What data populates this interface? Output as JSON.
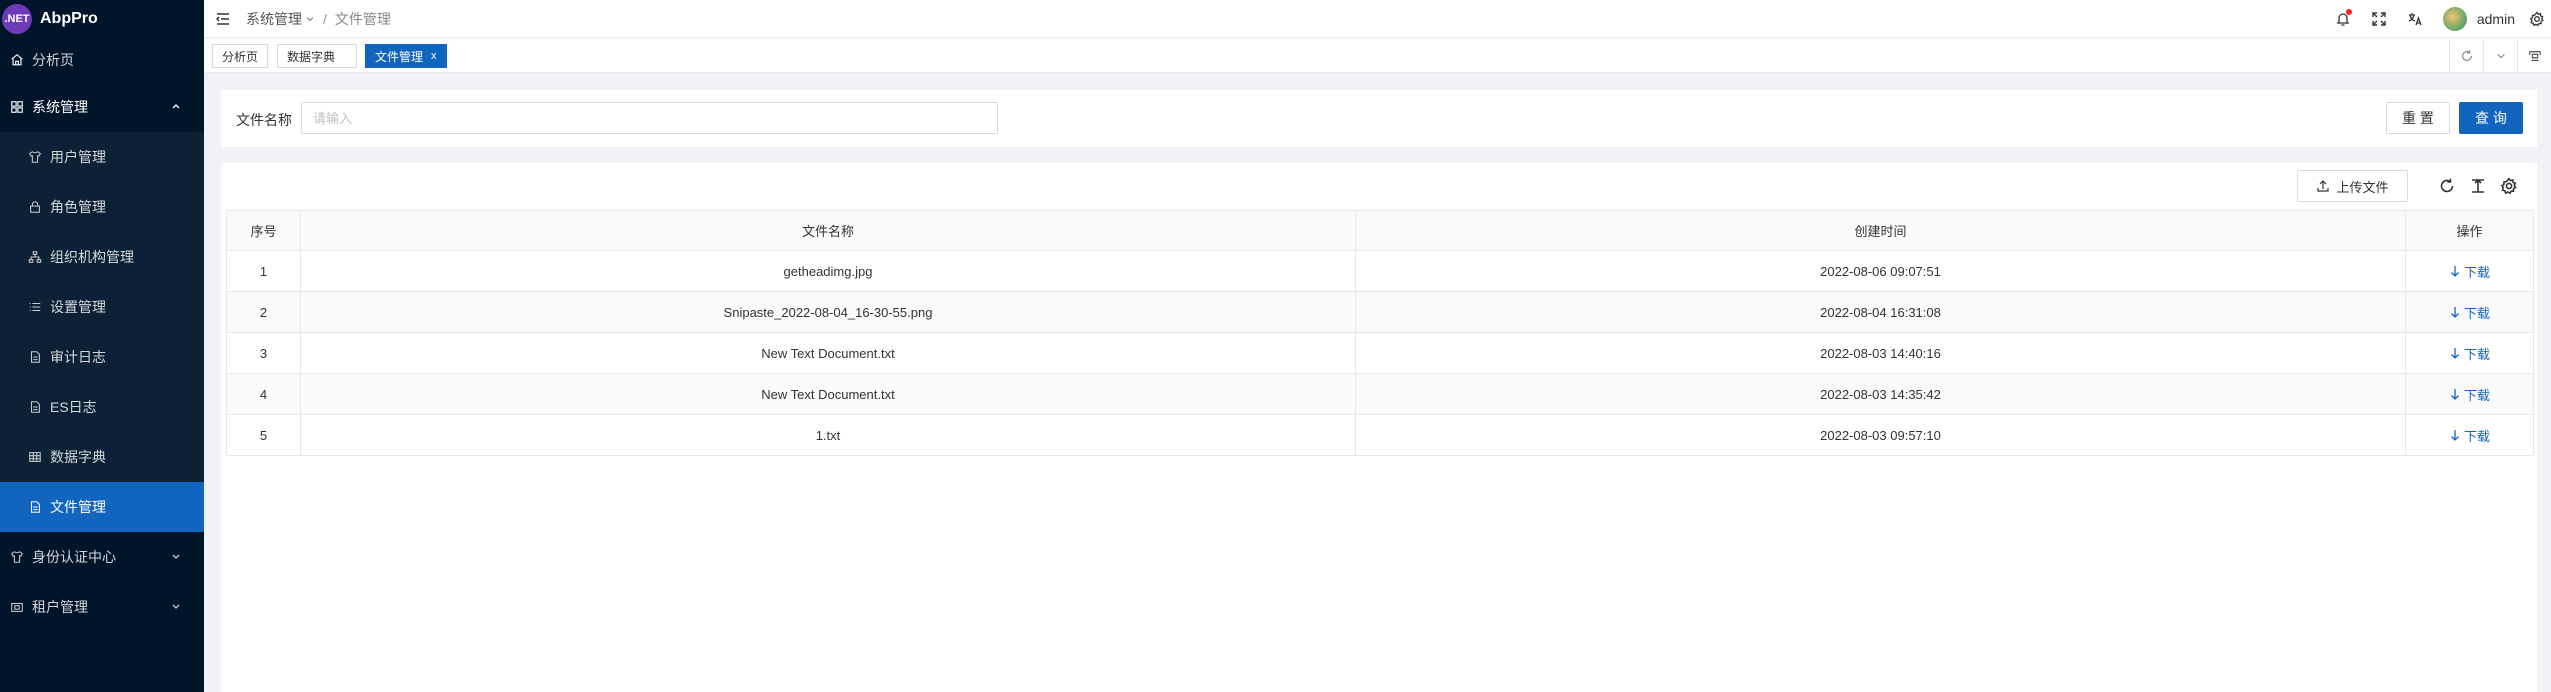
{
  "app": {
    "logo_badge": ".NET",
    "name": "AbpPro"
  },
  "sidebar": {
    "items": [
      {
        "label": "分析页",
        "icon": "home-icon"
      },
      {
        "label": "系统管理",
        "icon": "grid-icon",
        "expanded": true
      },
      {
        "label": "用户管理",
        "icon": "shirt-icon"
      },
      {
        "label": "角色管理",
        "icon": "lock-icon"
      },
      {
        "label": "组织机构管理",
        "icon": "org-icon"
      },
      {
        "label": "设置管理",
        "icon": "list-icon"
      },
      {
        "label": "审计日志",
        "icon": "file-icon"
      },
      {
        "label": "ES日志",
        "icon": "file-icon"
      },
      {
        "label": "数据字典",
        "icon": "table-icon"
      },
      {
        "label": "文件管理",
        "icon": "file-icon",
        "active": true
      },
      {
        "label": "身份认证中心",
        "icon": "shirt-icon"
      },
      {
        "label": "租户管理",
        "icon": "tenant-icon"
      }
    ]
  },
  "header": {
    "breadcrumb": [
      "系统管理",
      "文件管理"
    ],
    "username": "admin"
  },
  "tabs": [
    {
      "label": "分析页"
    },
    {
      "label": "数据字典"
    },
    {
      "label": "文件管理",
      "active": true,
      "close": "x"
    }
  ],
  "search": {
    "label": "文件名称",
    "placeholder": "请输入",
    "value": "",
    "reset_label": "重 置",
    "query_label": "查 询"
  },
  "table": {
    "upload_label": "上传文件",
    "columns": [
      "序号",
      "文件名称",
      "创建时间",
      "操作"
    ],
    "rows": [
      {
        "index": "1",
        "name": "getheadimg.jpg",
        "created": "2022-08-06 09:07:51",
        "action": "下载"
      },
      {
        "index": "2",
        "name": "Snipaste_2022-08-04_16-30-55.png",
        "created": "2022-08-04 16:31:08",
        "action": "下载"
      },
      {
        "index": "3",
        "name": "New Text Document.txt",
        "created": "2022-08-03 14:40:16",
        "action": "下载"
      },
      {
        "index": "4",
        "name": "New Text Document.txt",
        "created": "2022-08-03 14:35:42",
        "action": "下载"
      },
      {
        "index": "5",
        "name": "1.txt",
        "created": "2022-08-03 09:57:10",
        "action": "下载"
      }
    ]
  },
  "colors": {
    "sidebar_bg": "#001529",
    "primary": "#1265be",
    "active_menu": "#1265be"
  }
}
